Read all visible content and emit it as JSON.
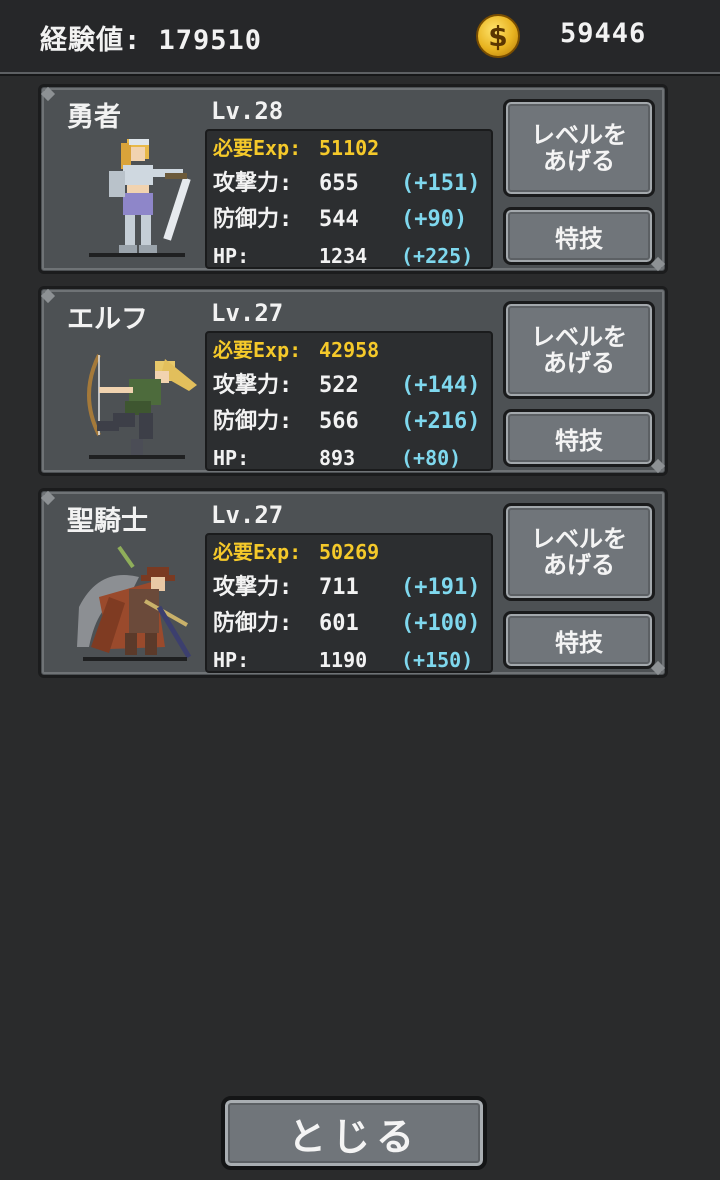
{
  "header": {
    "exp_label": "経験値: 179510",
    "coin_symbol": "$",
    "gold": "59446"
  },
  "characters": [
    {
      "name": "勇者",
      "level": "Lv.28",
      "exp_label": "必要Exp:",
      "exp_value": "51102",
      "atk_label": "攻撃力:",
      "atk": "655",
      "atk_bonus": "(+151)",
      "def_label": "防御力:",
      "def": "544",
      "def_bonus": "(+90)",
      "hp_label": "HP:",
      "hp": "1234",
      "hp_bonus": "(+225)",
      "level_up_button": "レベルを\nあげる",
      "skill_button": "特技",
      "portrait_icon": "hero-knight-sprite"
    },
    {
      "name": "エルフ",
      "level": "Lv.27",
      "exp_label": "必要Exp:",
      "exp_value": "42958",
      "atk_label": "攻撃力:",
      "atk": "522",
      "atk_bonus": "(+144)",
      "def_label": "防御力:",
      "def": "566",
      "def_bonus": "(+216)",
      "hp_label": "HP:",
      "hp": "893",
      "hp_bonus": "(+80)",
      "level_up_button": "レベルを\nあげる",
      "skill_button": "特技",
      "portrait_icon": "elf-archer-sprite"
    },
    {
      "name": "聖騎士",
      "level": "Lv.27",
      "exp_label": "必要Exp:",
      "exp_value": "50269",
      "atk_label": "攻撃力:",
      "atk": "711",
      "atk_bonus": "(+191)",
      "def_label": "防御力:",
      "def": "601",
      "def_bonus": "(+100)",
      "hp_label": "HP:",
      "hp": "1190",
      "hp_bonus": "(+150)",
      "level_up_button": "レベルを\nあげる",
      "skill_button": "特技",
      "portrait_icon": "paladin-sprite"
    }
  ],
  "footer": {
    "close_button": "とじる"
  },
  "colors": {
    "exp_yellow": "#f5c92a",
    "bonus_cyan": "#7fd8ee",
    "panel_gray": "#4d5154",
    "button_gray": "#70757a"
  }
}
